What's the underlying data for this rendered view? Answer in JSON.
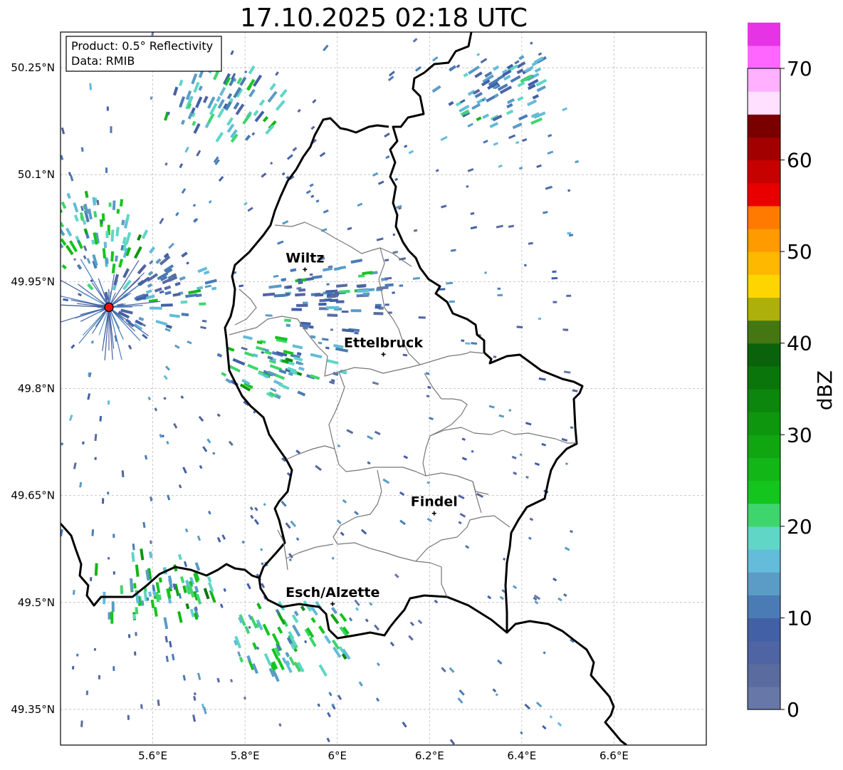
{
  "title": "17.10.2025 02:18 UTC",
  "info_box": {
    "product": "Product: 0.5° Reflectivity",
    "source": "Data: RMIB"
  },
  "map": {
    "extent": {
      "lon": [
        5.4,
        6.8
      ],
      "lat": [
        49.3,
        50.3
      ]
    },
    "lon_ticks": [
      {
        "value": 5.6,
        "label": "5.6°E"
      },
      {
        "value": 5.8,
        "label": "5.8°E"
      },
      {
        "value": 6.0,
        "label": "6°E"
      },
      {
        "value": 6.2,
        "label": "6.2°E"
      },
      {
        "value": 6.4,
        "label": "6.4°E"
      },
      {
        "value": 6.6,
        "label": "6.6°E"
      }
    ],
    "lat_ticks": [
      {
        "value": 50.25,
        "label": "50.25°N"
      },
      {
        "value": 50.1,
        "label": "50.1°N"
      },
      {
        "value": 49.95,
        "label": "49.95°N"
      },
      {
        "value": 49.8,
        "label": "49.8°N"
      },
      {
        "value": 49.65,
        "label": "49.65°N"
      },
      {
        "value": 49.5,
        "label": "49.5°N"
      },
      {
        "value": 49.35,
        "label": "49.35°N"
      }
    ],
    "grid": true,
    "cities": [
      {
        "name": "Wiltz",
        "lon": 5.93,
        "lat": 49.967
      },
      {
        "name": "Ettelbruck",
        "lon": 6.1,
        "lat": 49.848
      },
      {
        "name": "Findel",
        "lon": 6.21,
        "lat": 49.625
      },
      {
        "name": "Esch/Alzette",
        "lon": 5.99,
        "lat": 49.498
      }
    ],
    "radar_site": {
      "lon": 5.505,
      "lat": 49.914,
      "color": "#ee1111"
    }
  },
  "colorbar": {
    "label": "dBZ",
    "ticks": [
      0,
      10,
      20,
      30,
      40,
      50,
      60,
      70
    ],
    "range": [
      0,
      70
    ],
    "step": 2.5,
    "colors": [
      "#6677a8",
      "#5a6ba0",
      "#4e64a3",
      "#4260a6",
      "#4a7bb5",
      "#5a9cc6",
      "#63bcd9",
      "#5fd6c6",
      "#3fd56d",
      "#14c51e",
      "#12b616",
      "#10a612",
      "#0f960f",
      "#0c860c",
      "#0a750a",
      "#0a620a",
      "#447712",
      "#adb00a",
      "#ffd500",
      "#ffb800",
      "#ff9b00",
      "#ff7a00",
      "#e80000",
      "#c70000",
      "#a20000",
      "#7a0000",
      "#ffe0ff",
      "#ffb0ff",
      "#ff66ff",
      "#e633e6"
    ]
  },
  "chart_data": {
    "type": "heatmap",
    "title": "17.10.2025 02:18 UTC",
    "colorbar_label": "dBZ",
    "value_range": [
      0,
      70
    ],
    "echo_clusters": [
      {
        "lon": 6.35,
        "lat": 50.22,
        "dbz": 12
      },
      {
        "lon": 5.75,
        "lat": 50.2,
        "dbz": 14
      },
      {
        "lon": 5.6,
        "lat": 49.94,
        "dbz": 10
      },
      {
        "lon": 5.98,
        "lat": 49.93,
        "dbz": 8
      },
      {
        "lon": 5.45,
        "lat": 50.02,
        "dbz": 18
      },
      {
        "lon": 5.88,
        "lat": 49.84,
        "dbz": 16
      },
      {
        "lon": 5.9,
        "lat": 49.45,
        "dbz": 18
      },
      {
        "lon": 5.6,
        "lat": 49.52,
        "dbz": 20
      }
    ]
  }
}
